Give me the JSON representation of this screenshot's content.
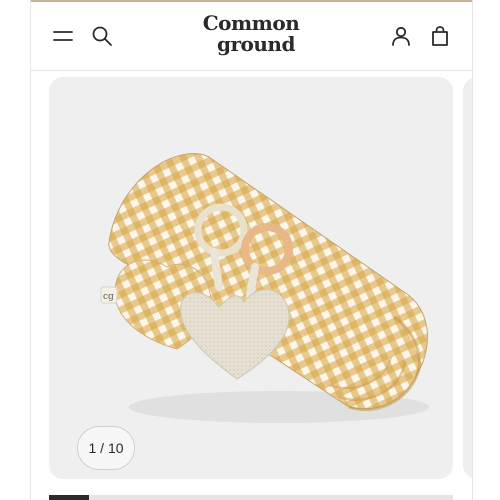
{
  "header": {
    "logo_line1": "Common",
    "logo_line2": "ground",
    "icons": [
      "menu-icon",
      "search-icon",
      "account-icon",
      "bag-icon"
    ]
  },
  "gallery": {
    "counter_text": "1 / 10",
    "current_slide": 1,
    "total_slides": 10,
    "image_tag_text": "cg"
  },
  "colors": {
    "gingham": "#d7a441",
    "linen": "#e6e0d3",
    "text": "#2a2a2a",
    "gallery_bg": "#efefef"
  }
}
